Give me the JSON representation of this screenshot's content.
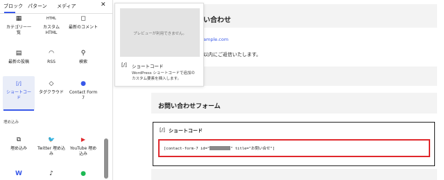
{
  "inserter": {
    "tabs": [
      "ブロック",
      "パターン",
      "メディア"
    ],
    "close_label": "✕",
    "blocks_row1": [
      {
        "label": "カテゴリー一\n覧",
        "icon": "grid-icon",
        "glyph": "▦"
      },
      {
        "label": "カスタム\nHTML",
        "icon": "html-icon",
        "glyph": "HTML"
      },
      {
        "label": "最新のコメント",
        "icon": "comment-icon",
        "glyph": "◻"
      }
    ],
    "blocks_row2": [
      {
        "label": "最新の投稿",
        "icon": "posts-icon",
        "glyph": "▤"
      },
      {
        "label": "RSS",
        "icon": "rss-icon",
        "glyph": "◠"
      },
      {
        "label": "検索",
        "icon": "search-icon",
        "glyph": "⚲"
      }
    ],
    "blocks_row3": [
      {
        "label": "ショートコー\nド",
        "icon": "shortcode-icon",
        "glyph": "[/]"
      },
      {
        "label": "タグクラウド",
        "icon": "tag-icon",
        "glyph": "◇"
      },
      {
        "label": "Contact Form\n7",
        "icon": "contact-form-icon",
        "glyph": "●"
      }
    ],
    "section_embed": "埋め込み",
    "blocks_row4": [
      {
        "label": "埋め込み",
        "icon": "embed-icon",
        "glyph": "⧉"
      },
      {
        "label": "Twitter 埋め込\nみ",
        "icon": "twitter-icon",
        "glyph": "🐦"
      },
      {
        "label": "YouTube 埋め\n込み",
        "icon": "youtube-icon",
        "glyph": "▶"
      }
    ],
    "blocks_row5": [
      {
        "label": "",
        "icon": "wordpress-icon",
        "glyph": "W"
      },
      {
        "label": "",
        "icon": "tiktok-icon",
        "glyph": "♪"
      },
      {
        "label": "",
        "icon": "spotify-icon",
        "glyph": "●"
      }
    ]
  },
  "popover": {
    "preview_text": "プレビューが利用できません。",
    "icon": "[/]",
    "title": "ショートコード",
    "description": "WordPress ショートコードで追加の カスタム要素を挿入します。"
  },
  "canvas": {
    "heading_contact": "い合わせ",
    "email": "ample.com",
    "reply_text": "以内にご返信いたします。",
    "heading_form": "お問い合わせフォーム",
    "shortcode_block": {
      "icon": "[/]",
      "title": "ショートコード",
      "code_prefix": "[contact-form-7 id=\"",
      "code_suffix": "\" title=\"お問い合せ\"]"
    }
  },
  "colors": {
    "accent": "#3858e9",
    "highlight": "#e0282c"
  }
}
